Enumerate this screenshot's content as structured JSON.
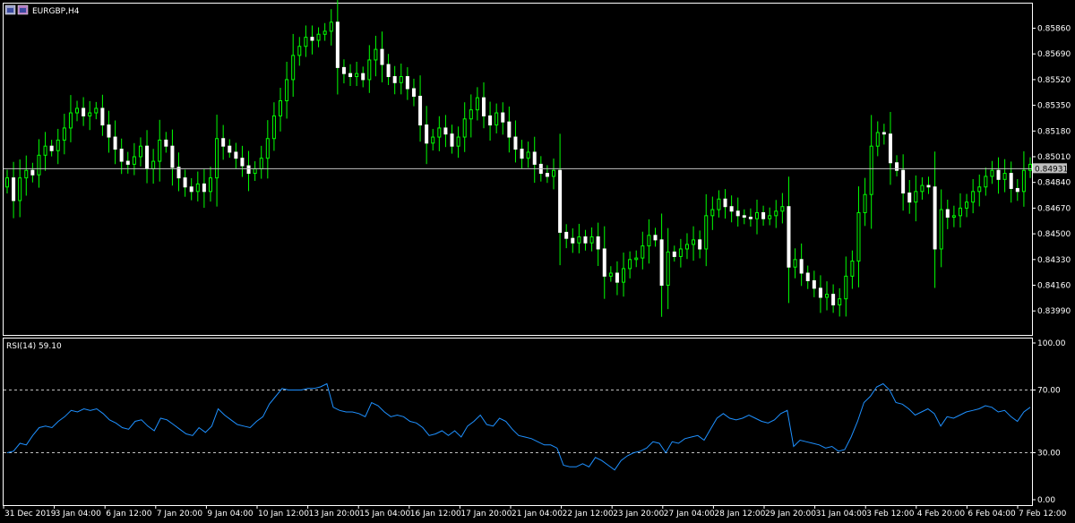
{
  "window": {
    "title": "EURGBP,H4",
    "icons": [
      "window-icon",
      "restore-icon"
    ]
  },
  "colors": {
    "background": "#000000",
    "frame": "#ffffff",
    "candle_up": "#00ff00",
    "candle_down": "#ffffff",
    "rsi_line": "#1e90ff",
    "current_price_line": "#c0c0c0",
    "level_line": "#c0c0c0",
    "readout_bg": "#c0c0c0"
  },
  "chart_data": [
    {
      "type": "candlestick",
      "title": "EURGBP,H4",
      "current_price": 0.84931,
      "current_price_label": "0.84931",
      "ylim": [
        0.8384,
        0.8597
      ],
      "yticks": [
        "0.85860",
        "0.85690",
        "0.85520",
        "0.85350",
        "0.85180",
        "0.85010",
        "0.84840",
        "0.84670",
        "0.84500",
        "0.84330",
        "0.84160",
        "0.83990"
      ],
      "closes": [
        0.8487,
        0.8472,
        0.8487,
        0.8492,
        0.8489,
        0.8502,
        0.8508,
        0.8505,
        0.8512,
        0.852,
        0.853,
        0.8533,
        0.8528,
        0.853,
        0.8533,
        0.8522,
        0.8514,
        0.8506,
        0.8498,
        0.8496,
        0.8501,
        0.8508,
        0.8493,
        0.8498,
        0.8512,
        0.8508,
        0.8494,
        0.8487,
        0.8481,
        0.8478,
        0.8483,
        0.8478,
        0.8487,
        0.8513,
        0.8508,
        0.8504,
        0.85,
        0.8495,
        0.849,
        0.8493,
        0.85,
        0.8513,
        0.8528,
        0.8538,
        0.8552,
        0.8568,
        0.8574,
        0.858,
        0.8578,
        0.8582,
        0.8584,
        0.859,
        0.856,
        0.8556,
        0.8554,
        0.8556,
        0.8552,
        0.8565,
        0.8572,
        0.8562,
        0.8554,
        0.855,
        0.8554,
        0.8546,
        0.8541,
        0.8522,
        0.851,
        0.8514,
        0.852,
        0.8516,
        0.8508,
        0.8514,
        0.8526,
        0.8532,
        0.854,
        0.8528,
        0.8522,
        0.853,
        0.8524,
        0.8514,
        0.8506,
        0.85,
        0.8504,
        0.8496,
        0.849,
        0.8488,
        0.8492,
        0.8451,
        0.8447,
        0.8444,
        0.8448,
        0.8444,
        0.8448,
        0.844,
        0.8422,
        0.8424,
        0.8418,
        0.8427,
        0.8433,
        0.8434,
        0.8442,
        0.8449,
        0.8446,
        0.8416,
        0.8438,
        0.8435,
        0.844,
        0.8443,
        0.8446,
        0.844,
        0.8462,
        0.8466,
        0.8473,
        0.8468,
        0.8465,
        0.8462,
        0.8461,
        0.846,
        0.8464,
        0.846,
        0.8462,
        0.8465,
        0.8468,
        0.8428,
        0.8433,
        0.8424,
        0.8419,
        0.8414,
        0.8408,
        0.841,
        0.8403,
        0.8407,
        0.8422,
        0.8432,
        0.8464,
        0.8476,
        0.8508,
        0.8517,
        0.8516,
        0.8497,
        0.8492,
        0.8477,
        0.8471,
        0.8478,
        0.8482,
        0.8481,
        0.844,
        0.8466,
        0.8461,
        0.8462,
        0.8467,
        0.8471,
        0.8478,
        0.8481,
        0.8488,
        0.8492,
        0.8486,
        0.849,
        0.848,
        0.8478,
        0.8492,
        0.8496
      ]
    },
    {
      "type": "line",
      "title": "RSI(14) 59.10",
      "indicator": "RSI(14)",
      "last_value": 59.1,
      "ylim": [
        0,
        100
      ],
      "yticks": [
        "100.00",
        "70.00",
        "30.00",
        "0.00"
      ],
      "levels": [
        70,
        30
      ],
      "values": [
        30,
        31,
        36,
        35,
        41,
        46,
        47,
        46,
        50,
        53,
        57,
        56,
        58,
        57,
        58,
        55,
        51,
        49,
        46,
        45,
        50,
        51,
        47,
        44,
        52,
        51,
        48,
        45,
        42,
        41,
        46,
        43,
        47,
        58,
        54,
        51,
        48,
        47,
        46,
        50,
        53,
        61,
        66,
        71,
        70,
        70,
        70,
        71,
        71,
        72,
        74,
        59,
        57,
        56,
        56,
        55,
        53,
        62,
        60,
        56,
        53,
        54,
        53,
        50,
        49,
        46,
        41,
        42,
        44,
        41,
        44,
        40,
        47,
        50,
        54,
        48,
        47,
        52,
        50,
        45,
        41,
        40,
        39,
        37,
        35,
        35,
        33,
        22,
        21,
        21,
        23,
        21,
        27,
        25,
        22,
        19,
        25,
        28,
        30,
        31,
        33,
        37,
        36,
        30,
        37,
        36,
        39,
        40,
        41,
        38,
        45,
        52,
        55,
        52,
        51,
        52,
        54,
        52,
        50,
        49,
        51,
        55,
        57,
        34,
        38,
        37,
        36,
        35,
        33,
        34,
        31,
        32,
        40,
        50,
        62,
        66,
        72,
        74,
        70,
        62,
        61,
        58,
        54,
        56,
        58,
        55,
        47,
        53,
        52,
        54,
        56,
        57,
        58,
        60,
        59,
        56,
        57,
        53,
        50,
        56,
        59
      ]
    }
  ],
  "x_axis": {
    "labels": [
      "31 Dec 2019",
      "3 Jan 04:00",
      "6 Jan 12:00",
      "7 Jan 20:00",
      "9 Jan 04:00",
      "10 Jan 12:00",
      "13 Jan 20:00",
      "15 Jan 04:00",
      "16 Jan 12:00",
      "17 Jan 20:00",
      "21 Jan 04:00",
      "22 Jan 12:00",
      "23 Jan 20:00",
      "27 Jan 04:00",
      "28 Jan 12:00",
      "29 Jan 20:00",
      "31 Jan 04:00",
      "3 Feb 12:00",
      "4 Feb 20:00",
      "6 Feb 04:00",
      "7 Feb 12:00"
    ]
  }
}
